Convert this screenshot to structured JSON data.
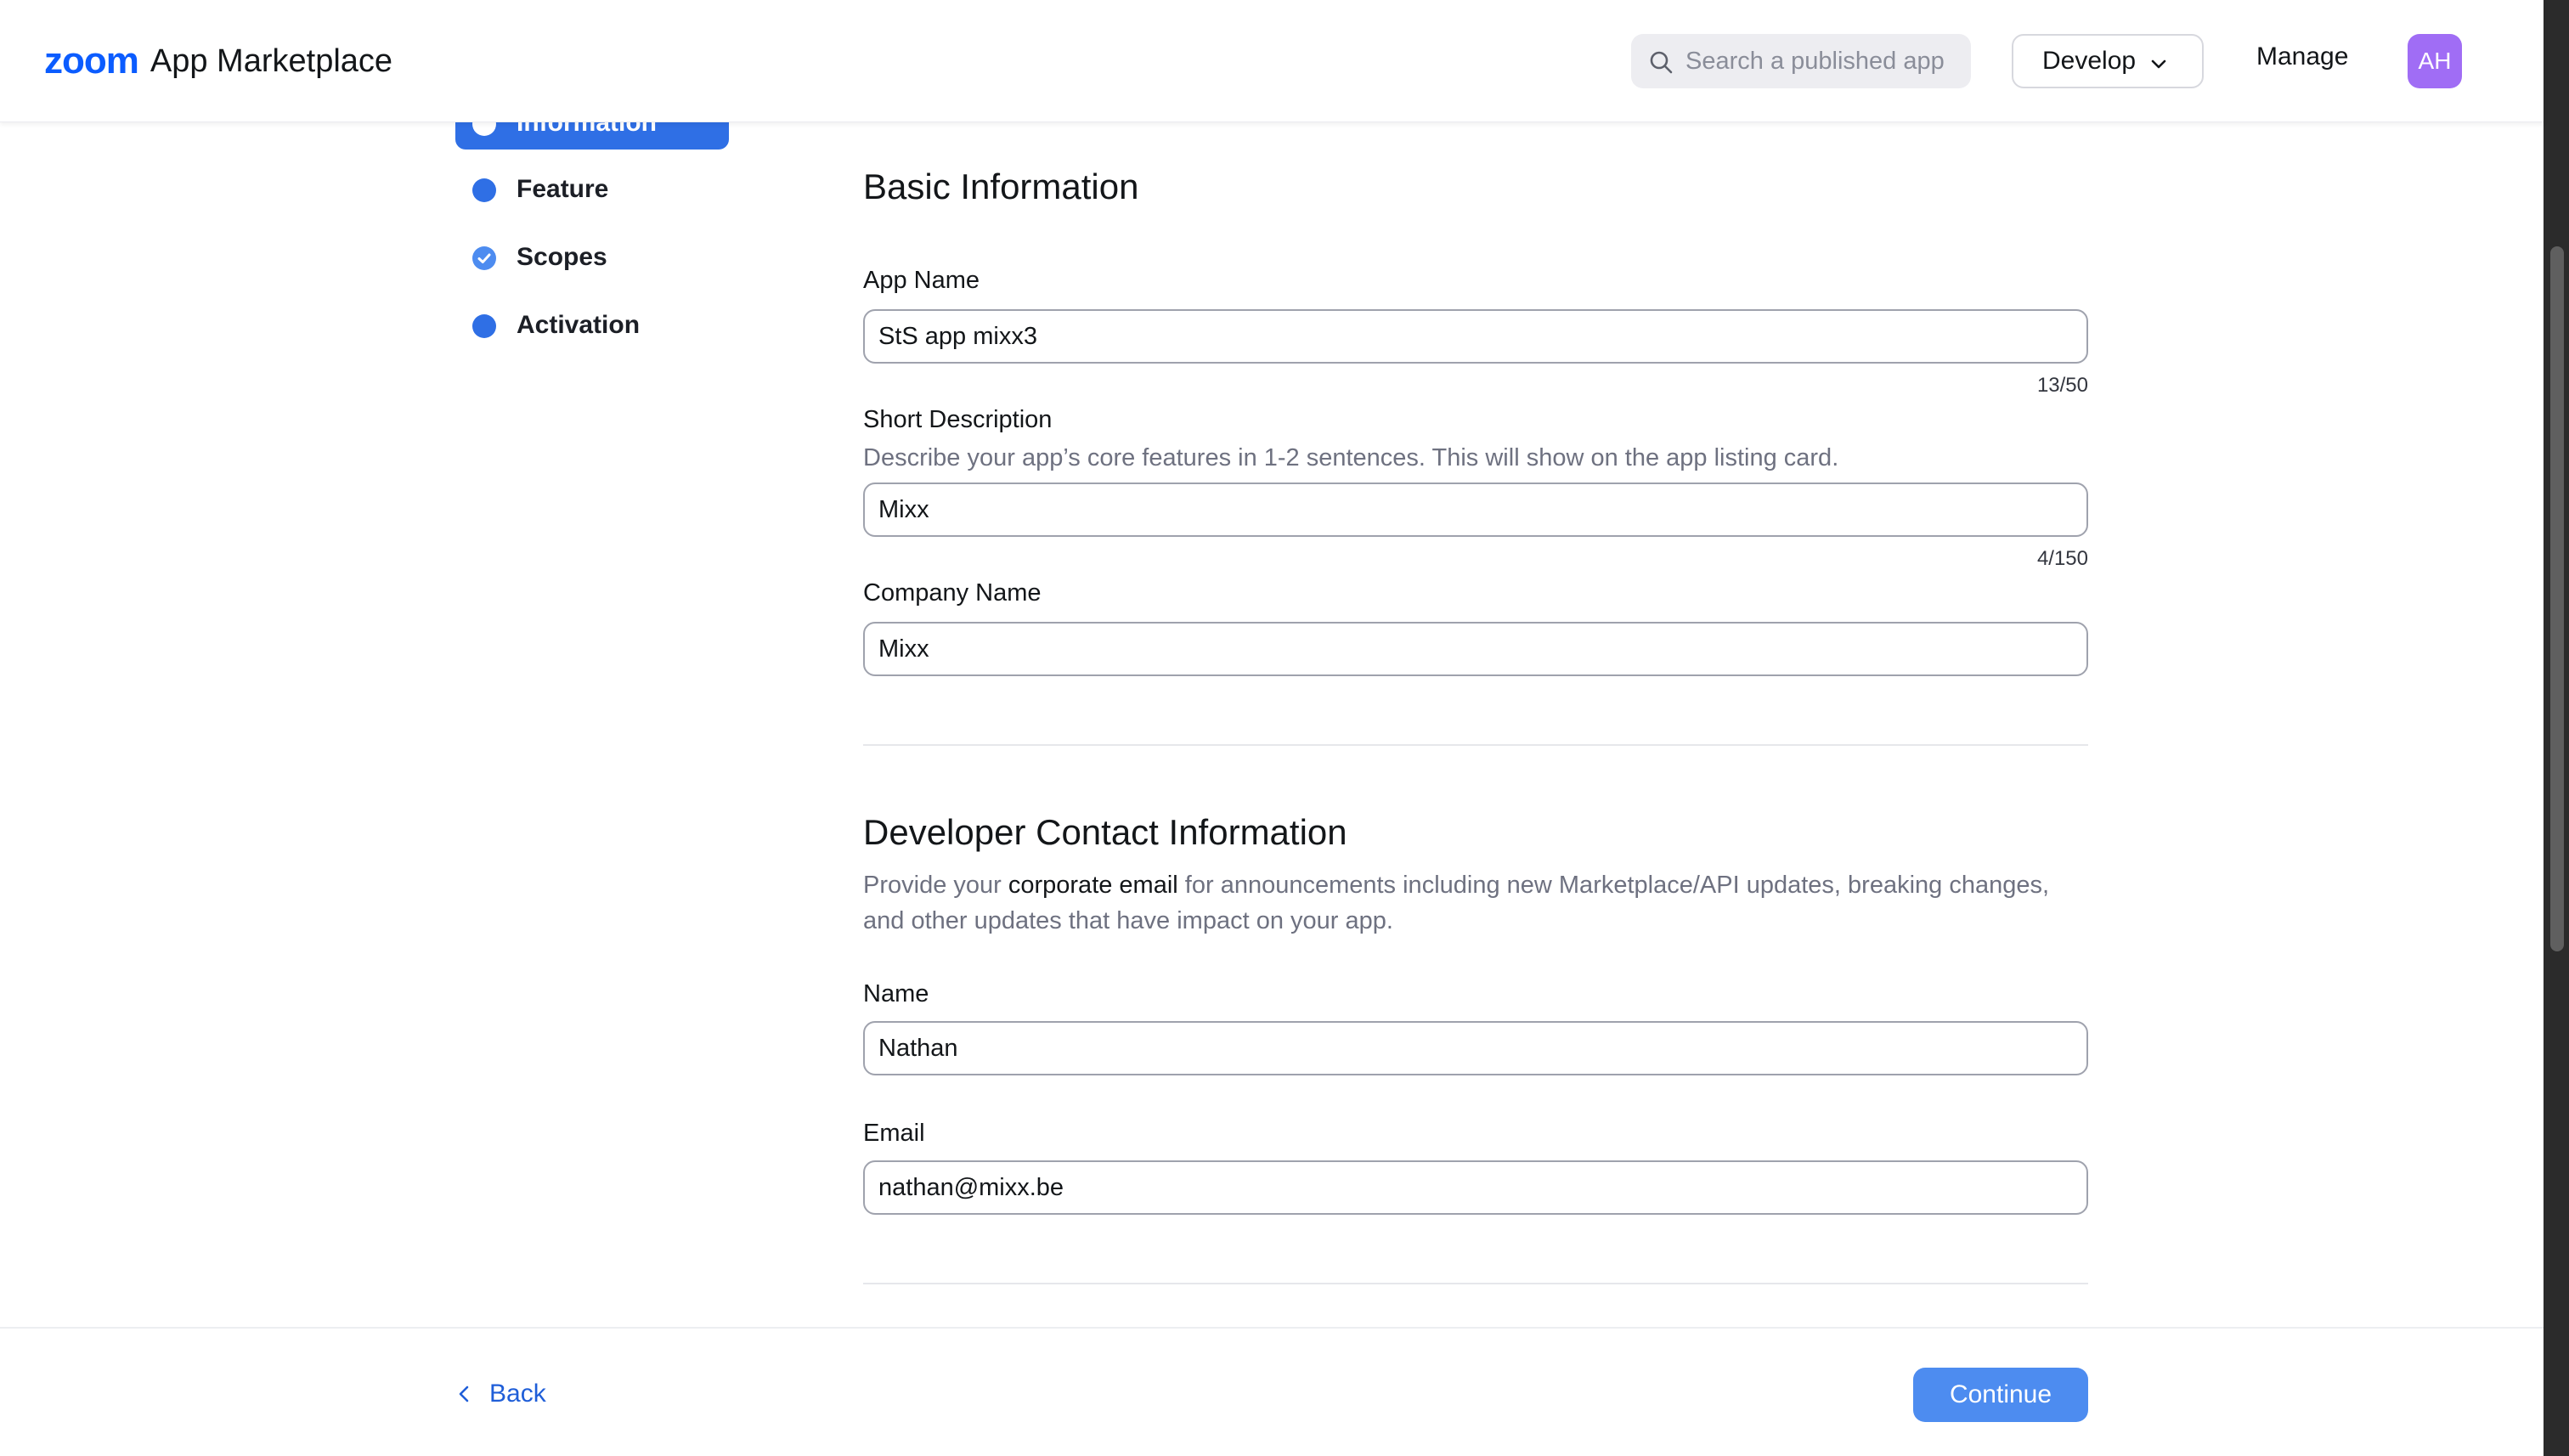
{
  "header": {
    "logo_brand": "zoom",
    "logo_text": "App Marketplace",
    "search_placeholder": "Search a published app",
    "develop_label": "Develop",
    "manage_label": "Manage",
    "avatar_initials": "AH",
    "accent_color": "#0b5cff",
    "avatar_color": "#a06df5"
  },
  "steps": {
    "active_label": "Information",
    "items": [
      {
        "label": "Feature",
        "state": "dot"
      },
      {
        "label": "Scopes",
        "state": "checked"
      },
      {
        "label": "Activation",
        "state": "dot"
      }
    ]
  },
  "basic_info": {
    "title": "Basic Information",
    "app_name_label": "App Name",
    "app_name_value": "StS app mixx3",
    "app_name_counter": "13/50",
    "short_desc_label": "Short Description",
    "short_desc_help": "Describe your app’s core features in 1-2 sentences. This will show on the app listing card.",
    "short_desc_value": "Mixx",
    "short_desc_counter": "4/150",
    "company_label": "Company Name",
    "company_value": "Mixx"
  },
  "developer_contact": {
    "title": "Developer Contact Information",
    "help_prefix": "Provide your ",
    "help_emphasis": "corporate email",
    "help_suffix": " for announcements including new Marketplace/API updates, breaking changes, and other updates that have impact on your app.",
    "name_label": "Name",
    "name_value": "Nathan",
    "email_label": "Email",
    "email_value": "nathan@mixx.be"
  },
  "footer": {
    "back_label": "Back",
    "continue_label": "Continue"
  }
}
